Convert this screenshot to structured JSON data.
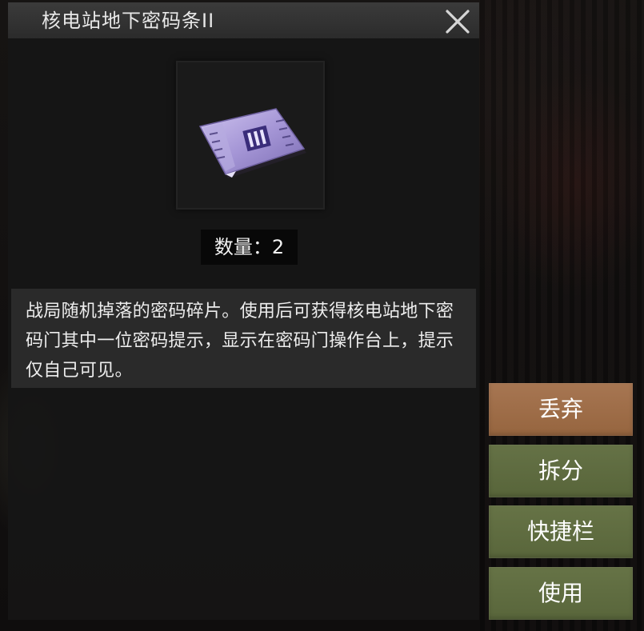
{
  "item": {
    "title": "核电站地下密码条II",
    "quantity_text": "数量：2",
    "quantity": 2,
    "description": "战局随机掉落的密码碎片。使用后可获得核电站地下密码门其中一位密码提示，显示在密码门操作台上，提示仅自己可见。",
    "image_icon": "purple-password-card-icon"
  },
  "actions": {
    "discard": "丢弃",
    "split": "拆分",
    "quickbar": "快捷栏",
    "use": "使用"
  },
  "icons": {
    "close": "close-icon"
  },
  "colors": {
    "discard_button": "#a0704b",
    "action_button": "#5e6b3f",
    "panel": "#1c1c1c",
    "title_bar": "#333333",
    "item_card": "#8d7fc0"
  }
}
